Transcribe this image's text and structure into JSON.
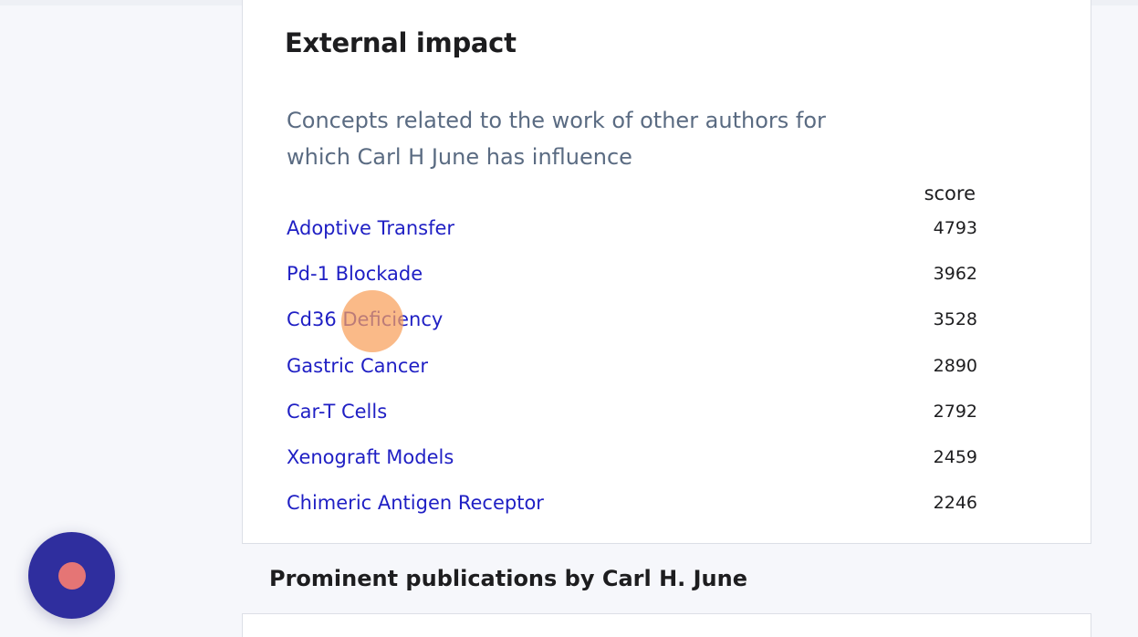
{
  "external_impact": {
    "title": "External impact",
    "subtitle": "Concepts related to the work of other authors for which Carl H June has influence",
    "score_header": "score",
    "concepts": [
      {
        "label": "Adoptive Transfer",
        "score": "4793"
      },
      {
        "label": "Pd-1 Blockade",
        "score": "3962"
      },
      {
        "label": "Cd36 Deficiency",
        "score": "3528"
      },
      {
        "label": "Gastric Cancer",
        "score": "2890"
      },
      {
        "label": "Car-T Cells",
        "score": "2792"
      },
      {
        "label": "Xenograft Models",
        "score": "2459"
      },
      {
        "label": "Chimeric Antigen Receptor",
        "score": "2246"
      }
    ]
  },
  "publications": {
    "heading": "Prominent publications by Carl H. June"
  },
  "colors": {
    "link": "#1f1fc4",
    "subtitle": "#5a6b82",
    "fab": "#2f2e9e",
    "fab_dot": "#e57575",
    "click_marker": "#f8a05a"
  }
}
